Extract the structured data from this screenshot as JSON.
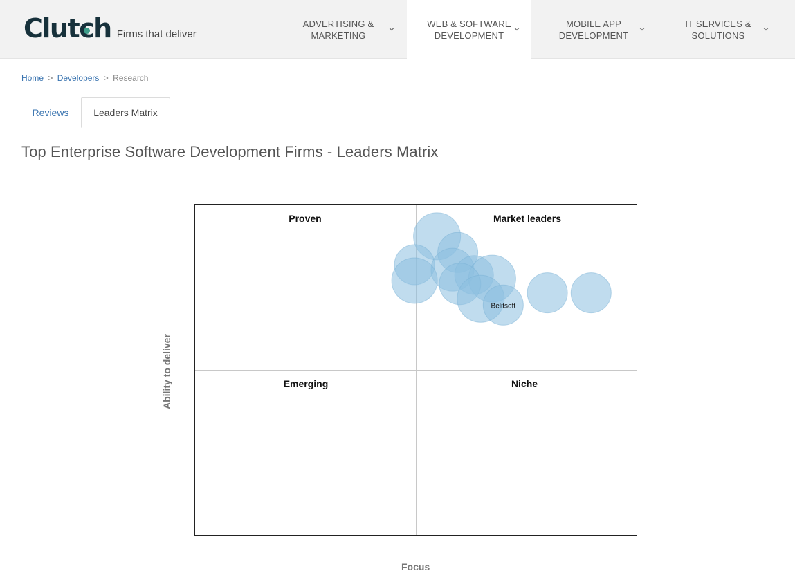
{
  "brand": {
    "name": "Clutch",
    "tagline": "Firms that deliver"
  },
  "nav": [
    {
      "line1": "ADVERTISING &",
      "line2": "MARKETING"
    },
    {
      "line1": "WEB & SOFTWARE",
      "line2": "DEVELOPMENT"
    },
    {
      "line1": "MOBILE APP",
      "line2": "DEVELOPMENT"
    },
    {
      "line1": "IT SERVICES &",
      "line2": "SOLUTIONS"
    }
  ],
  "breadcrumb": {
    "home": "Home",
    "developers": "Developers",
    "current": "Research",
    "separator": ">"
  },
  "tabs": {
    "reviews": "Reviews",
    "leaders_matrix": "Leaders Matrix"
  },
  "page": {
    "title": "Top Enterprise Software Development Firms - Leaders Matrix"
  },
  "chart_data": {
    "type": "scatter",
    "xlabel": "Focus",
    "ylabel": "Ability to deliver",
    "xlim": [
      0,
      1
    ],
    "ylim": [
      0,
      1
    ],
    "grid": false,
    "quadrants": {
      "top_left": "Proven",
      "top_right": "Market leaders",
      "bottom_left": "Emerging",
      "bottom_right": "Niche"
    },
    "points": [
      {
        "x": 0.548,
        "y": 0.904,
        "r": 34,
        "label": ""
      },
      {
        "x": 0.595,
        "y": 0.855,
        "r": 29,
        "label": ""
      },
      {
        "x": 0.497,
        "y": 0.818,
        "r": 29,
        "label": ""
      },
      {
        "x": 0.583,
        "y": 0.803,
        "r": 31,
        "label": ""
      },
      {
        "x": 0.632,
        "y": 0.787,
        "r": 28,
        "label": ""
      },
      {
        "x": 0.673,
        "y": 0.776,
        "r": 34,
        "label": ""
      },
      {
        "x": 0.497,
        "y": 0.77,
        "r": 33,
        "label": ""
      },
      {
        "x": 0.6,
        "y": 0.76,
        "r": 30,
        "label": ""
      },
      {
        "x": 0.798,
        "y": 0.733,
        "r": 29,
        "label": ""
      },
      {
        "x": 0.897,
        "y": 0.733,
        "r": 29,
        "label": ""
      },
      {
        "x": 0.647,
        "y": 0.715,
        "r": 34,
        "label": ""
      },
      {
        "x": 0.698,
        "y": 0.696,
        "r": 29,
        "label": "Belitsoft"
      }
    ],
    "colors": {
      "bubble_fill": "#8cbfe0",
      "bubble_stroke": "#7ab2d6"
    }
  }
}
